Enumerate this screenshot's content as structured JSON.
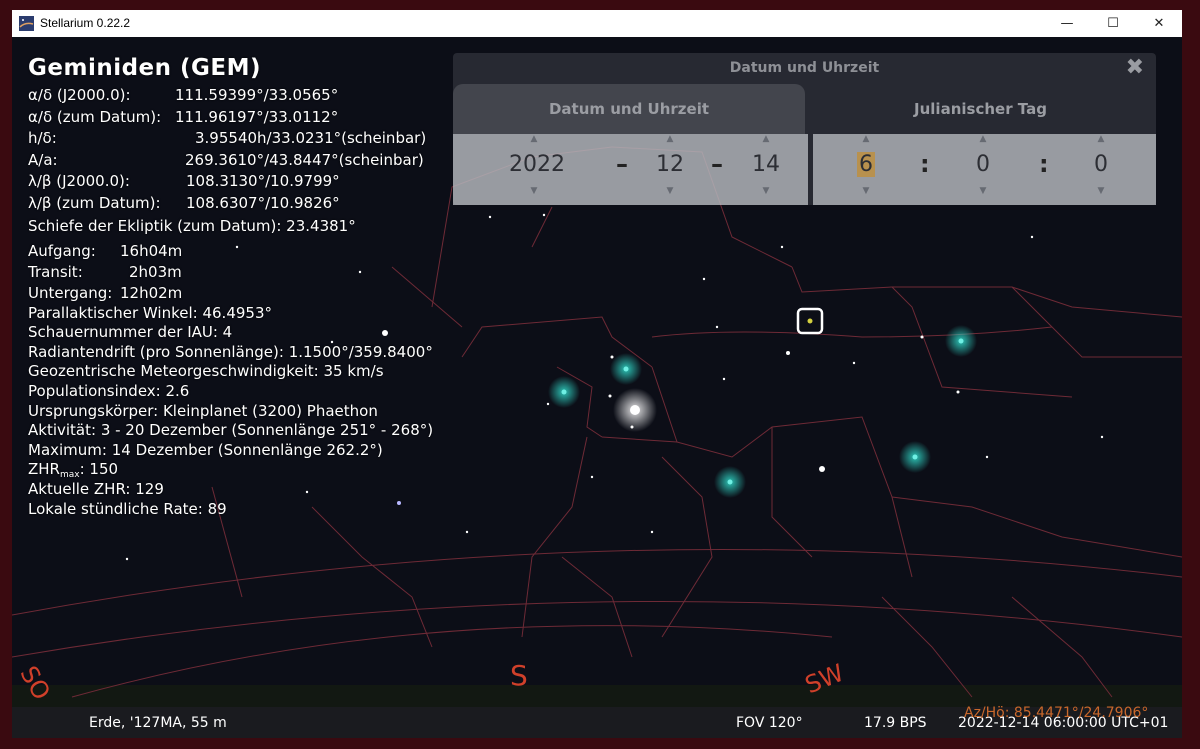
{
  "window": {
    "title": "Stellarium 0.22.2",
    "minimize": "—",
    "maximize": "☐",
    "close": "✕"
  },
  "object_info": {
    "title": "Geminiden (GEM)",
    "coord_rows": [
      {
        "label": "α/δ (J2000.0):",
        "value": "111.59399°/33.0565°"
      },
      {
        "label": "α/δ (zum Datum):",
        "value": "111.96197°/33.0112°"
      },
      {
        "label": "h/δ:",
        "value": "3.95540h/33.0231°(scheinbar)"
      },
      {
        "label": "A/a:",
        "value": "269.3610°/43.8447°(scheinbar)"
      },
      {
        "label": "λ/β (J2000.0):",
        "value": "108.3130°/10.9799°"
      },
      {
        "label": "λ/β (zum Datum):",
        "value": "108.6307°/10.9826°"
      }
    ],
    "ecliptic": "Schiefe der Ekliptik (zum Datum): 23.4381°",
    "rise_rows": [
      {
        "label": "Aufgang:",
        "value": "16h04m"
      },
      {
        "label": "Transit:",
        "value": "2h03m"
      },
      {
        "label": "Untergang:",
        "value": "12h02m"
      }
    ],
    "lines": [
      "Parallaktischer Winkel: 46.4953°",
      "Schauernummer der IAU: 4",
      "Radiantendrift (pro Sonnenlänge): 1.1500°/359.8400°",
      "Geozentrische Meteorgeschwindigkeit: 35 km/s",
      "Populationsindex: 2.6",
      "Ursprungskörper: Kleinplanet (3200) Phaethon",
      "Aktivität: 3 - 20 Dezember (Sonnenlänge 251° - 268°)",
      "Maximum: 14 Dezember (Sonnenlänge 262.2°)"
    ],
    "zhr_max_label": "ZHR",
    "zhr_max_sub": "max",
    "zhr_max_value": ": 150",
    "current_zhr": "Aktuelle ZHR: 129",
    "local_rate": "Lokale stündliche Rate: 89"
  },
  "datetime_dialog": {
    "title": "Datum und Uhrzeit",
    "close": "✖",
    "tab_date": "Datum und Uhrzeit",
    "tab_julian": "Julianischer Tag",
    "year": "2022",
    "month": "12",
    "day": "14",
    "hour": "6",
    "minute": "0",
    "second": "0",
    "date_sep": "–",
    "time_sep": ":"
  },
  "cardinals": {
    "so": "SO",
    "s": "S",
    "sw": "SW"
  },
  "status": {
    "location": "Erde, '127MA, 55 m",
    "fov": "FOV 120°",
    "fps": "17.9 BPS",
    "datetime": "2022-12-14 06:00:00 UTC+01",
    "az_alt": "Az/Hö: 85.4471°/24.7906°"
  },
  "colors": {
    "accent": "#d0402a",
    "constellation_lines": "#6e2a36",
    "status_orange": "#c9682b"
  }
}
